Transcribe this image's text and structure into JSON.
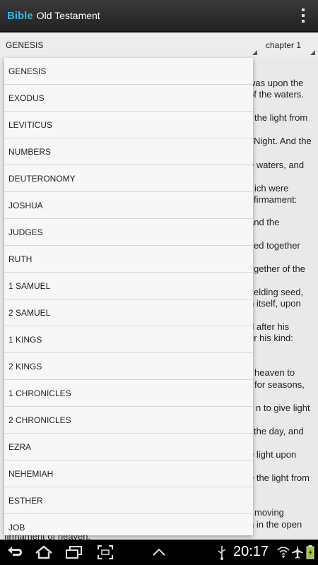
{
  "header": {
    "app_name": "Bible",
    "title": "Old Testament",
    "overflow_icon": "overflow-menu-icon"
  },
  "selectors": {
    "book": "GENESIS",
    "chapter": "chapter 1"
  },
  "reading": {
    "visible_fragments": [
      "was upon the",
      "of the waters.",
      "the light from",
      "Night. And the",
      "e waters, and",
      "ich were",
      "firmament:",
      "and the",
      "ed together",
      "gether of the",
      "elding seed,",
      "n itself, upon",
      "d after his",
      "er his kind:",
      "heaven to",
      "for seasons,",
      "n to give light",
      "the day, and",
      "e light upon",
      "e the light from",
      "moving",
      "n in the open",
      "firmament of heaven."
    ]
  },
  "dropdown": {
    "items": [
      "GENESIS",
      "EXODUS",
      "LEVITICUS",
      "NUMBERS",
      "DEUTERONOMY",
      "JOSHUA",
      "JUDGES",
      "RUTH",
      "1 SAMUEL",
      "2 SAMUEL",
      "1 KINGS",
      "2 KINGS",
      "1 CHRONICLES",
      "2 CHRONICLES",
      "EZRA",
      "NEHEMIAH",
      "ESTHER",
      "JOB"
    ]
  },
  "statusbar": {
    "time": "20:17",
    "icons": [
      "back-icon",
      "home-icon",
      "recent-apps-icon",
      "screenshot-icon",
      "up-chevron-icon",
      "usb-icon",
      "wifi-icon",
      "airplane-icon",
      "battery-icon"
    ]
  }
}
